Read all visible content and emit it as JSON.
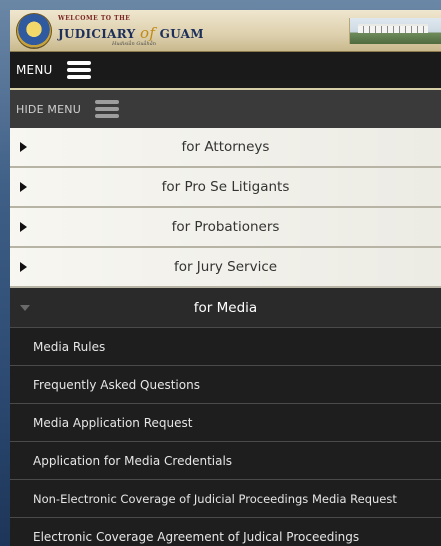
{
  "header": {
    "welcome": "WELCOME TO THE",
    "brand_left": "JUDICIARY",
    "brand_amp": "of",
    "brand_right": "GUAM",
    "sub": "Hudisiån Guåhån"
  },
  "menu_bar": {
    "label": "MENU"
  },
  "hide_bar": {
    "label": "HIDE MENU"
  },
  "sections": [
    {
      "label": "for Attorneys"
    },
    {
      "label": "for Pro Se Litigants"
    },
    {
      "label": "for Probationers"
    },
    {
      "label": "for Jury Service"
    },
    {
      "label": "for Media"
    }
  ],
  "media_items": [
    {
      "label": "Media Rules"
    },
    {
      "label": "Frequently Asked Questions"
    },
    {
      "label": "Media Application Request"
    },
    {
      "label": "Application for Media Credentials"
    },
    {
      "label": "Non-Electronic Coverage of Judicial Proceedings Media Request"
    },
    {
      "label": "Electronic Coverage Agreement of Judical Proceedings"
    }
  ],
  "colors": {
    "accent_gold": "#c08a14",
    "navy": "#1c2e5a",
    "dark_bar": "#1a1a1a"
  }
}
